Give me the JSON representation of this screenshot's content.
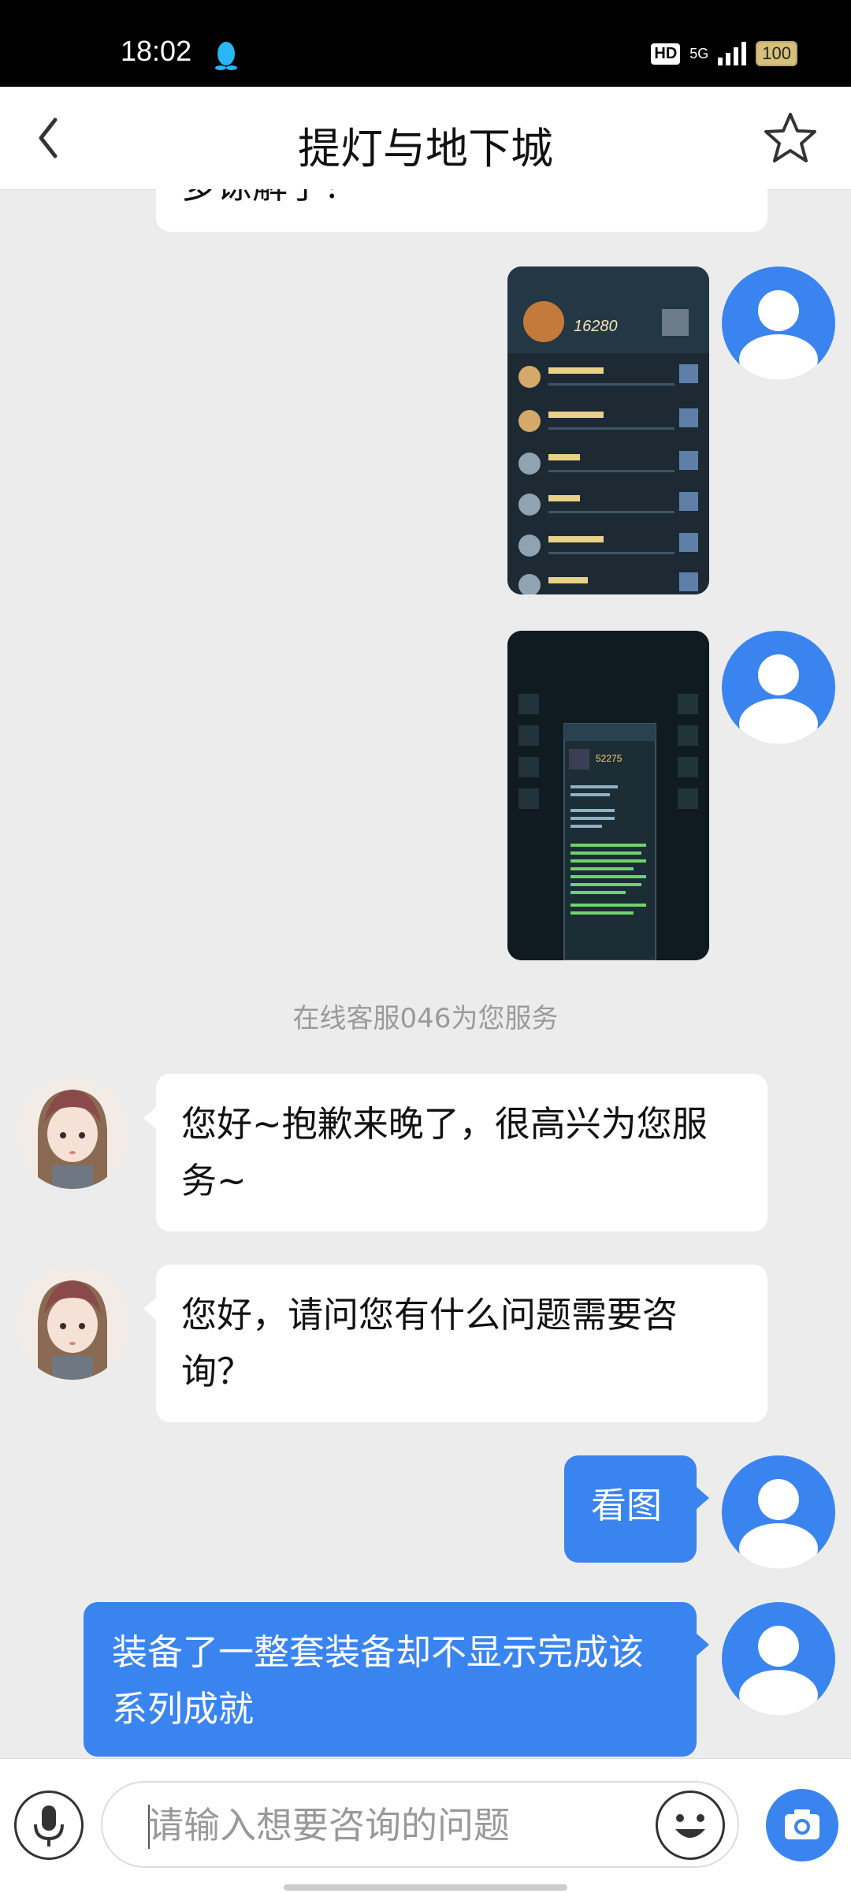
{
  "status_bar": {
    "time": "18:02",
    "network_badge": "HD",
    "signal_label": "5G",
    "battery": "100"
  },
  "header": {
    "title": "提灯与地下城",
    "back_icon": "chevron-left-icon",
    "favorite_icon": "star-outline-icon"
  },
  "messages": {
    "partial_top": "多谅解了！",
    "image1_caption": "16280",
    "image2_caption": "52275",
    "system_note": "在线客服046为您服务",
    "agent_msg1": "您好~抱歉来晚了，很高兴为您服务~",
    "agent_msg2": "您好，请问您有什么问题需要咨询？",
    "user_msg1": "看图",
    "user_msg2": "装备了一整套装备却不显示完成该系列成就"
  },
  "input_bar": {
    "placeholder": "请输入想要咨询的问题",
    "mic_icon": "microphone-icon",
    "emoji_icon": "emoji-icon",
    "camera_icon": "camera-icon"
  },
  "colors": {
    "accent": "#3a84f0",
    "background": "#ececec",
    "bubble_white": "#ffffff"
  }
}
